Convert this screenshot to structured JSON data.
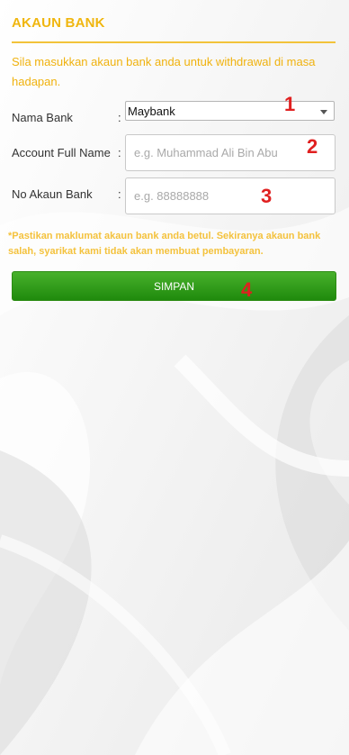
{
  "header": {
    "title": "AKAUN BANK",
    "intro": "Sila masukkan akaun bank anda untuk withdrawal di masa hadapan."
  },
  "form": {
    "bank": {
      "label": "Nama Bank",
      "colon": ":",
      "value": "Maybank"
    },
    "full_name": {
      "label": "Account Full Name",
      "colon": ":",
      "placeholder": "e.g. Muhammad Ali Bin Abu",
      "value": ""
    },
    "account_no": {
      "label": "No Akaun Bank",
      "colon": ":",
      "placeholder": "e.g. 88888888",
      "value": ""
    }
  },
  "notice": "*Pastikan maklumat akaun bank anda betul. Sekiranya akaun bank salah, syarikat kami tidak akan membuat pembayaran.",
  "save_button": {
    "label": "SIMPAN"
  },
  "markers": [
    "1",
    "2",
    "3",
    "4"
  ],
  "colors": {
    "accent": "#f0b60f",
    "button": "#2e9a18",
    "marker": "#e02020"
  }
}
